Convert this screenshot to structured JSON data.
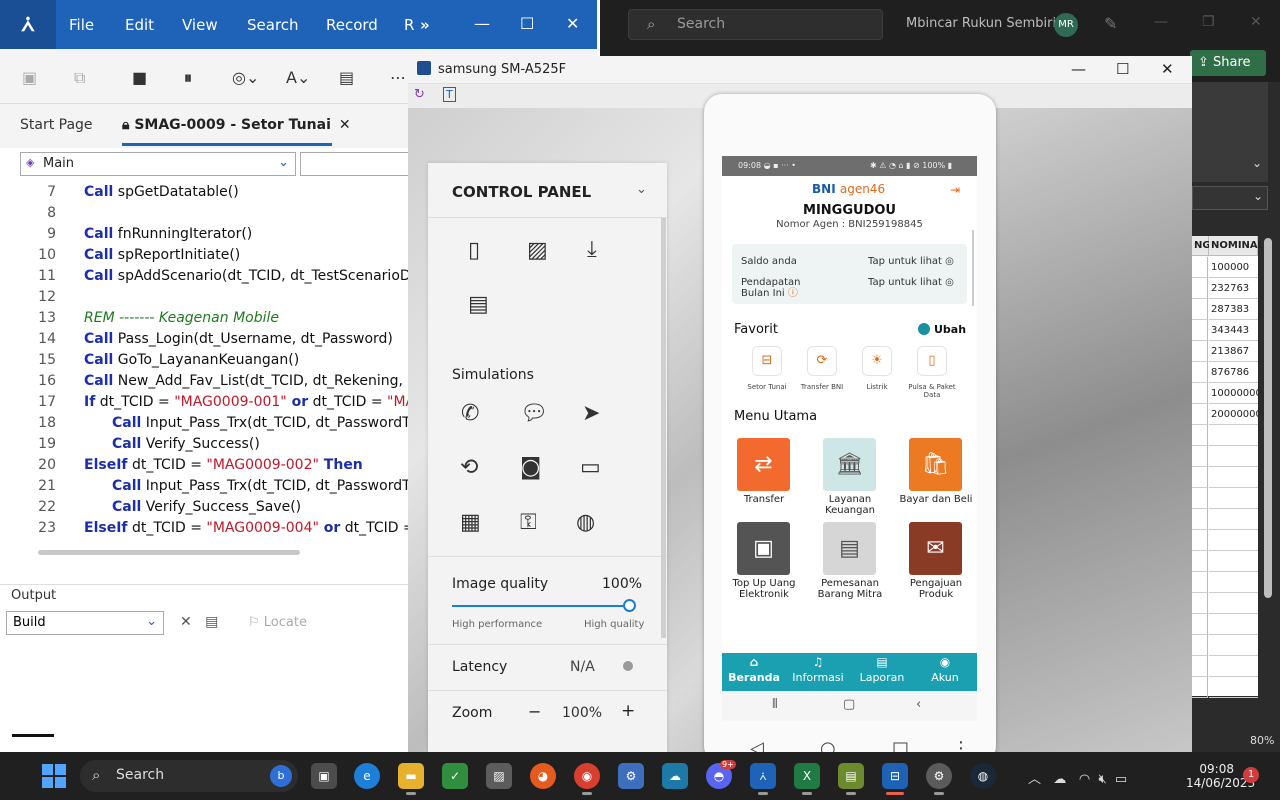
{
  "background_app": {
    "search_placeholder": "Search",
    "user_name": "Mbincar Rukun Sembiring",
    "user_initials": "MR",
    "share_label": "Share",
    "sheet_headers": [
      "NG",
      "NOMINAL"
    ],
    "sheet_values": [
      "100000",
      "232763",
      "287383",
      "343443",
      "213867",
      "876786",
      "10000000",
      "20000000"
    ],
    "zoom": "80%"
  },
  "ide": {
    "menu": [
      "File",
      "Edit",
      "View",
      "Search",
      "Record",
      "R"
    ],
    "tabs": {
      "start": "Start Page",
      "active": "SMAG-0009 - Setor Tunai"
    },
    "procedure_combo": "Main",
    "code_lines": [
      {
        "n": "7",
        "parts": [
          {
            "t": "Call",
            "c": "kw"
          },
          {
            "t": " spGetDatatable()",
            "c": ""
          }
        ]
      },
      {
        "n": "8",
        "parts": []
      },
      {
        "n": "9",
        "parts": [
          {
            "t": "Call",
            "c": "kw"
          },
          {
            "t": " fnRunningIterator()",
            "c": ""
          }
        ]
      },
      {
        "n": "10",
        "parts": [
          {
            "t": "Call",
            "c": "kw"
          },
          {
            "t": " spReportInitiate()",
            "c": ""
          }
        ]
      },
      {
        "n": "11",
        "parts": [
          {
            "t": "Call",
            "c": "kw"
          },
          {
            "t": " spAddScenario(dt_TCID, dt_TestScenarioDe",
            "c": ""
          }
        ]
      },
      {
        "n": "12",
        "parts": []
      },
      {
        "n": "13",
        "parts": [
          {
            "t": "REM ------- Keagenan Mobile",
            "c": "rem"
          }
        ]
      },
      {
        "n": "14",
        "parts": [
          {
            "t": "Call",
            "c": "kw"
          },
          {
            "t": " Pass_Login(dt_Username, dt_Password)",
            "c": ""
          }
        ]
      },
      {
        "n": "15",
        "parts": [
          {
            "t": "Call",
            "c": "kw"
          },
          {
            "t": " GoTo_LayananKeuangan()",
            "c": ""
          }
        ]
      },
      {
        "n": "16",
        "parts": [
          {
            "t": "Call",
            "c": "kw"
          },
          {
            "t": " New_Add_Fav_List(dt_TCID, dt_Rekening, d",
            "c": ""
          }
        ]
      },
      {
        "n": "17",
        "parts": [
          {
            "t": "If",
            "c": "kw"
          },
          {
            "t": " dt_TCID = ",
            "c": ""
          },
          {
            "t": "\"MAG0009-001\"",
            "c": "str"
          },
          {
            "t": " or",
            "c": "kw"
          },
          {
            "t": " dt_TCID = ",
            "c": ""
          },
          {
            "t": "\"MA",
            "c": "str"
          }
        ]
      },
      {
        "n": "18",
        "indent": 1,
        "parts": [
          {
            "t": "Call",
            "c": "kw"
          },
          {
            "t": " Input_Pass_Trx(dt_TCID, dt_PasswordT",
            "c": ""
          }
        ]
      },
      {
        "n": "19",
        "indent": 1,
        "parts": [
          {
            "t": "Call",
            "c": "kw"
          },
          {
            "t": " Verify_Success()",
            "c": ""
          }
        ]
      },
      {
        "n": "20",
        "parts": [
          {
            "t": "ElseIf",
            "c": "kw"
          },
          {
            "t": " dt_TCID = ",
            "c": ""
          },
          {
            "t": "\"MAG0009-002\"",
            "c": "str"
          },
          {
            "t": " Then",
            "c": "kw"
          }
        ]
      },
      {
        "n": "21",
        "indent": 1,
        "parts": [
          {
            "t": "Call",
            "c": "kw"
          },
          {
            "t": " Input_Pass_Trx(dt_TCID, dt_PasswordT",
            "c": ""
          }
        ]
      },
      {
        "n": "22",
        "indent": 1,
        "parts": [
          {
            "t": "Call",
            "c": "kw"
          },
          {
            "t": " Verify_Success_Save()",
            "c": ""
          }
        ]
      },
      {
        "n": "23",
        "parts": [
          {
            "t": "ElseIf",
            "c": "kw"
          },
          {
            "t": " dt_TCID = ",
            "c": ""
          },
          {
            "t": "\"MAG0009-004\"",
            "c": "str"
          },
          {
            "t": " or",
            "c": "kw"
          },
          {
            "t": " dt_TCID = ",
            "c": ""
          }
        ]
      }
    ],
    "output": {
      "title": "Output",
      "build": "Build",
      "locate": "Locate"
    }
  },
  "device_window": {
    "title": "samsung SM-A525F",
    "control_panel": {
      "title": "CONTROL PANEL",
      "simulations_title": "Simulations",
      "image_quality_label": "Image quality",
      "image_quality_value": "100%",
      "image_quality_level": 1.0,
      "high_performance": "High performance",
      "high_quality": "High quality",
      "latency_label": "Latency",
      "latency_value": "N/A",
      "zoom_label": "Zoom",
      "zoom_value": "100%"
    }
  },
  "phone": {
    "status_time": "09:08",
    "status_battery": "100%",
    "brand_prefix": "BNI ",
    "brand_suffix": "agen46",
    "agent_name": "MINGGUDOU",
    "agent_number": "Nomor Agen : BNI259198845",
    "saldo_label": "Saldo anda",
    "pendapatan_label": "Pendapatan Bulan Ini",
    "tap_label": "Tap untuk lihat",
    "favorit_title": "Favorit",
    "ubah_label": "Ubah",
    "favorites": [
      "Setor Tunai",
      "Transfer BNI",
      "Listrik",
      "Pulsa & Paket Data"
    ],
    "menu_title": "Menu Utama",
    "menu": [
      {
        "label": "Transfer",
        "color": "#f26a2e"
      },
      {
        "label": "Layanan Keuangan",
        "color": "#cfe6e6"
      },
      {
        "label": "Bayar dan Beli",
        "color": "#ec7a22"
      },
      {
        "label": "Top Up Uang Elektronik",
        "color": "#545454"
      },
      {
        "label": "Pemesanan Barang Mitra",
        "color": "#d6d6d6"
      },
      {
        "label": "Pengajuan Produk",
        "color": "#8a3b26"
      }
    ],
    "bottom_nav": [
      "Beranda",
      "Informasi",
      "Laporan",
      "Akun"
    ]
  },
  "taskbar": {
    "search_label": "Search",
    "time": "09:08",
    "date": "14/06/2023",
    "notification_count": "1",
    "badge": "9+"
  }
}
